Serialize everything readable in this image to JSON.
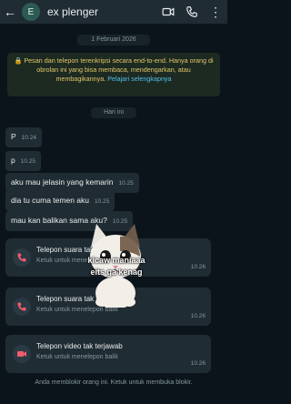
{
  "header": {
    "contact_name": "ex plenger",
    "avatar_letter": "E"
  },
  "chat": {
    "date_label": "1 Februari 2026",
    "encryption_notice": "Pesan dan telepon terenkripsi secara end-to-end. Hanya orang di obrolan ini yang bisa membaca, mendengarkan, atau membagikannya.",
    "encryption_link": "Pelajari selengkapnya",
    "today_label": "Hari ini",
    "messages": [
      {
        "text": "P",
        "time": "10.24"
      },
      {
        "text": "p",
        "time": "10.25"
      },
      {
        "text": "aku mau jelasin yang kemarin",
        "time": "10.25"
      },
      {
        "text": "dia tu cuma temen aku",
        "time": "10.25"
      },
      {
        "text": "mau kan balikan sama aku?",
        "time": "10.25"
      }
    ],
    "calls": [
      {
        "title": "Telepon suara tak terjawab",
        "subtitle": "Ketuk untuk menelepon balik",
        "time": "10.26"
      },
      {
        "title": "Telepon suara tak terjawab",
        "subtitle": "Ketuk untuk menelepon balik",
        "time": "10.26"
      },
      {
        "title": "Telepon video tak terjawab",
        "subtitle": "Ketuk untuk menelepon balik",
        "time": "10.26"
      }
    ],
    "blocked_notice": "Anda memblokir orang ini. Ketuk untuk membuka blokir."
  },
  "overlay": {
    "caption_line1": "kicaw maniaaa",
    "caption_line2": "eits ga kenag"
  },
  "colors": {
    "background": "#0b141a",
    "header": "#1f2c34",
    "bubble": "#202c33",
    "missed_call": "#f15c6d",
    "notice_text": "#e3c66b",
    "link": "#53bdeb"
  }
}
